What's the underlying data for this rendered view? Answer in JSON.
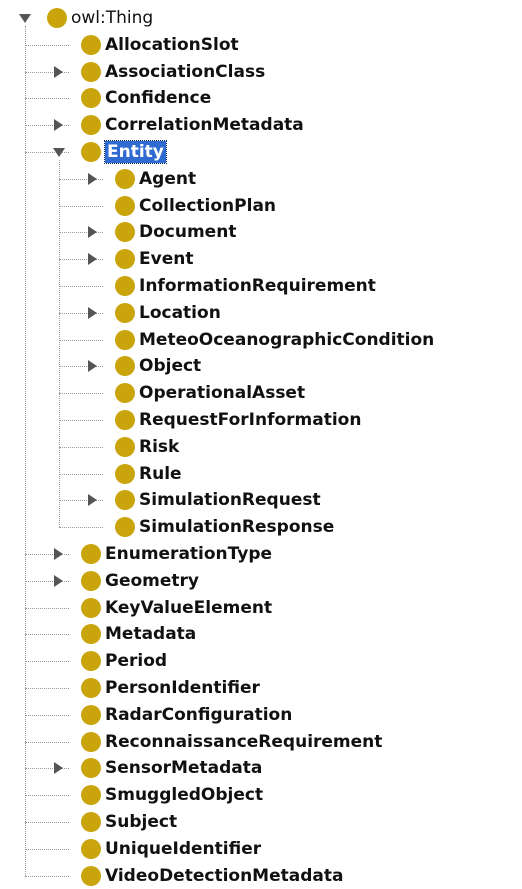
{
  "palette": {
    "class_icon": "#c9a40b",
    "selection": "#2f6bd1",
    "connector": "#9a9a9a"
  },
  "tree": {
    "root": "owl:Thing",
    "items": [
      {
        "label": "owl:Thing",
        "depth": 0,
        "state": "expanded",
        "selected": false
      },
      {
        "label": "AllocationSlot",
        "depth": 1,
        "state": "leaf",
        "selected": false
      },
      {
        "label": "AssociationClass",
        "depth": 1,
        "state": "collapsed",
        "selected": false
      },
      {
        "label": "Confidence",
        "depth": 1,
        "state": "leaf",
        "selected": false
      },
      {
        "label": "CorrelationMetadata",
        "depth": 1,
        "state": "collapsed",
        "selected": false
      },
      {
        "label": "Entity",
        "depth": 1,
        "state": "expanded",
        "selected": true
      },
      {
        "label": "Agent",
        "depth": 2,
        "state": "collapsed",
        "selected": false
      },
      {
        "label": "CollectionPlan",
        "depth": 2,
        "state": "leaf",
        "selected": false
      },
      {
        "label": "Document",
        "depth": 2,
        "state": "collapsed",
        "selected": false
      },
      {
        "label": "Event",
        "depth": 2,
        "state": "collapsed",
        "selected": false
      },
      {
        "label": "InformationRequirement",
        "depth": 2,
        "state": "leaf",
        "selected": false
      },
      {
        "label": "Location",
        "depth": 2,
        "state": "collapsed",
        "selected": false
      },
      {
        "label": "MeteoOceanographicCondition",
        "depth": 2,
        "state": "leaf",
        "selected": false
      },
      {
        "label": "Object",
        "depth": 2,
        "state": "collapsed",
        "selected": false
      },
      {
        "label": "OperationalAsset",
        "depth": 2,
        "state": "leaf",
        "selected": false
      },
      {
        "label": "RequestForInformation",
        "depth": 2,
        "state": "leaf",
        "selected": false
      },
      {
        "label": "Risk",
        "depth": 2,
        "state": "leaf",
        "selected": false
      },
      {
        "label": "Rule",
        "depth": 2,
        "state": "leaf",
        "selected": false
      },
      {
        "label": "SimulationRequest",
        "depth": 2,
        "state": "collapsed",
        "selected": false
      },
      {
        "label": "SimulationResponse",
        "depth": 2,
        "state": "leaf",
        "selected": false
      },
      {
        "label": "EnumerationType",
        "depth": 1,
        "state": "collapsed",
        "selected": false
      },
      {
        "label": "Geometry",
        "depth": 1,
        "state": "collapsed",
        "selected": false
      },
      {
        "label": "KeyValueElement",
        "depth": 1,
        "state": "leaf",
        "selected": false
      },
      {
        "label": "Metadata",
        "depth": 1,
        "state": "leaf",
        "selected": false
      },
      {
        "label": "Period",
        "depth": 1,
        "state": "leaf",
        "selected": false
      },
      {
        "label": "PersonIdentifier",
        "depth": 1,
        "state": "leaf",
        "selected": false
      },
      {
        "label": "RadarConfiguration",
        "depth": 1,
        "state": "leaf",
        "selected": false
      },
      {
        "label": "ReconnaissanceRequirement",
        "depth": 1,
        "state": "leaf",
        "selected": false
      },
      {
        "label": "SensorMetadata",
        "depth": 1,
        "state": "collapsed",
        "selected": false
      },
      {
        "label": "SmuggledObject",
        "depth": 1,
        "state": "leaf",
        "selected": false
      },
      {
        "label": "Subject",
        "depth": 1,
        "state": "leaf",
        "selected": false
      },
      {
        "label": "UniqueIdentifier",
        "depth": 1,
        "state": "leaf",
        "selected": false
      },
      {
        "label": "VideoDetectionMetadata",
        "depth": 1,
        "state": "leaf",
        "selected": false
      }
    ]
  }
}
